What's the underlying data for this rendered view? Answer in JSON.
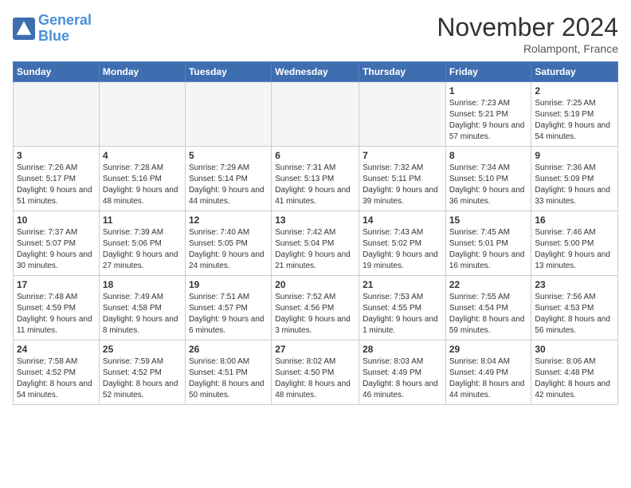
{
  "logo": {
    "line1": "General",
    "line2": "Blue"
  },
  "title": "November 2024",
  "location": "Rolampont, France",
  "headers": [
    "Sunday",
    "Monday",
    "Tuesday",
    "Wednesday",
    "Thursday",
    "Friday",
    "Saturday"
  ],
  "weeks": [
    [
      {
        "day": "",
        "text": "",
        "empty": true
      },
      {
        "day": "",
        "text": "",
        "empty": true
      },
      {
        "day": "",
        "text": "",
        "empty": true
      },
      {
        "day": "",
        "text": "",
        "empty": true
      },
      {
        "day": "",
        "text": "",
        "empty": true
      },
      {
        "day": "1",
        "text": "Sunrise: 7:23 AM\nSunset: 5:21 PM\nDaylight: 9 hours and 57 minutes.",
        "empty": false
      },
      {
        "day": "2",
        "text": "Sunrise: 7:25 AM\nSunset: 5:19 PM\nDaylight: 9 hours and 54 minutes.",
        "empty": false
      }
    ],
    [
      {
        "day": "3",
        "text": "Sunrise: 7:26 AM\nSunset: 5:17 PM\nDaylight: 9 hours and 51 minutes.",
        "empty": false
      },
      {
        "day": "4",
        "text": "Sunrise: 7:28 AM\nSunset: 5:16 PM\nDaylight: 9 hours and 48 minutes.",
        "empty": false
      },
      {
        "day": "5",
        "text": "Sunrise: 7:29 AM\nSunset: 5:14 PM\nDaylight: 9 hours and 44 minutes.",
        "empty": false
      },
      {
        "day": "6",
        "text": "Sunrise: 7:31 AM\nSunset: 5:13 PM\nDaylight: 9 hours and 41 minutes.",
        "empty": false
      },
      {
        "day": "7",
        "text": "Sunrise: 7:32 AM\nSunset: 5:11 PM\nDaylight: 9 hours and 39 minutes.",
        "empty": false
      },
      {
        "day": "8",
        "text": "Sunrise: 7:34 AM\nSunset: 5:10 PM\nDaylight: 9 hours and 36 minutes.",
        "empty": false
      },
      {
        "day": "9",
        "text": "Sunrise: 7:36 AM\nSunset: 5:09 PM\nDaylight: 9 hours and 33 minutes.",
        "empty": false
      }
    ],
    [
      {
        "day": "10",
        "text": "Sunrise: 7:37 AM\nSunset: 5:07 PM\nDaylight: 9 hours and 30 minutes.",
        "empty": false
      },
      {
        "day": "11",
        "text": "Sunrise: 7:39 AM\nSunset: 5:06 PM\nDaylight: 9 hours and 27 minutes.",
        "empty": false
      },
      {
        "day": "12",
        "text": "Sunrise: 7:40 AM\nSunset: 5:05 PM\nDaylight: 9 hours and 24 minutes.",
        "empty": false
      },
      {
        "day": "13",
        "text": "Sunrise: 7:42 AM\nSunset: 5:04 PM\nDaylight: 9 hours and 21 minutes.",
        "empty": false
      },
      {
        "day": "14",
        "text": "Sunrise: 7:43 AM\nSunset: 5:02 PM\nDaylight: 9 hours and 19 minutes.",
        "empty": false
      },
      {
        "day": "15",
        "text": "Sunrise: 7:45 AM\nSunset: 5:01 PM\nDaylight: 9 hours and 16 minutes.",
        "empty": false
      },
      {
        "day": "16",
        "text": "Sunrise: 7:46 AM\nSunset: 5:00 PM\nDaylight: 9 hours and 13 minutes.",
        "empty": false
      }
    ],
    [
      {
        "day": "17",
        "text": "Sunrise: 7:48 AM\nSunset: 4:59 PM\nDaylight: 9 hours and 11 minutes.",
        "empty": false
      },
      {
        "day": "18",
        "text": "Sunrise: 7:49 AM\nSunset: 4:58 PM\nDaylight: 9 hours and 8 minutes.",
        "empty": false
      },
      {
        "day": "19",
        "text": "Sunrise: 7:51 AM\nSunset: 4:57 PM\nDaylight: 9 hours and 6 minutes.",
        "empty": false
      },
      {
        "day": "20",
        "text": "Sunrise: 7:52 AM\nSunset: 4:56 PM\nDaylight: 9 hours and 3 minutes.",
        "empty": false
      },
      {
        "day": "21",
        "text": "Sunrise: 7:53 AM\nSunset: 4:55 PM\nDaylight: 9 hours and 1 minute.",
        "empty": false
      },
      {
        "day": "22",
        "text": "Sunrise: 7:55 AM\nSunset: 4:54 PM\nDaylight: 8 hours and 59 minutes.",
        "empty": false
      },
      {
        "day": "23",
        "text": "Sunrise: 7:56 AM\nSunset: 4:53 PM\nDaylight: 8 hours and 56 minutes.",
        "empty": false
      }
    ],
    [
      {
        "day": "24",
        "text": "Sunrise: 7:58 AM\nSunset: 4:52 PM\nDaylight: 8 hours and 54 minutes.",
        "empty": false
      },
      {
        "day": "25",
        "text": "Sunrise: 7:59 AM\nSunset: 4:52 PM\nDaylight: 8 hours and 52 minutes.",
        "empty": false
      },
      {
        "day": "26",
        "text": "Sunrise: 8:00 AM\nSunset: 4:51 PM\nDaylight: 8 hours and 50 minutes.",
        "empty": false
      },
      {
        "day": "27",
        "text": "Sunrise: 8:02 AM\nSunset: 4:50 PM\nDaylight: 8 hours and 48 minutes.",
        "empty": false
      },
      {
        "day": "28",
        "text": "Sunrise: 8:03 AM\nSunset: 4:49 PM\nDaylight: 8 hours and 46 minutes.",
        "empty": false
      },
      {
        "day": "29",
        "text": "Sunrise: 8:04 AM\nSunset: 4:49 PM\nDaylight: 8 hours and 44 minutes.",
        "empty": false
      },
      {
        "day": "30",
        "text": "Sunrise: 8:06 AM\nSunset: 4:48 PM\nDaylight: 8 hours and 42 minutes.",
        "empty": false
      }
    ]
  ]
}
